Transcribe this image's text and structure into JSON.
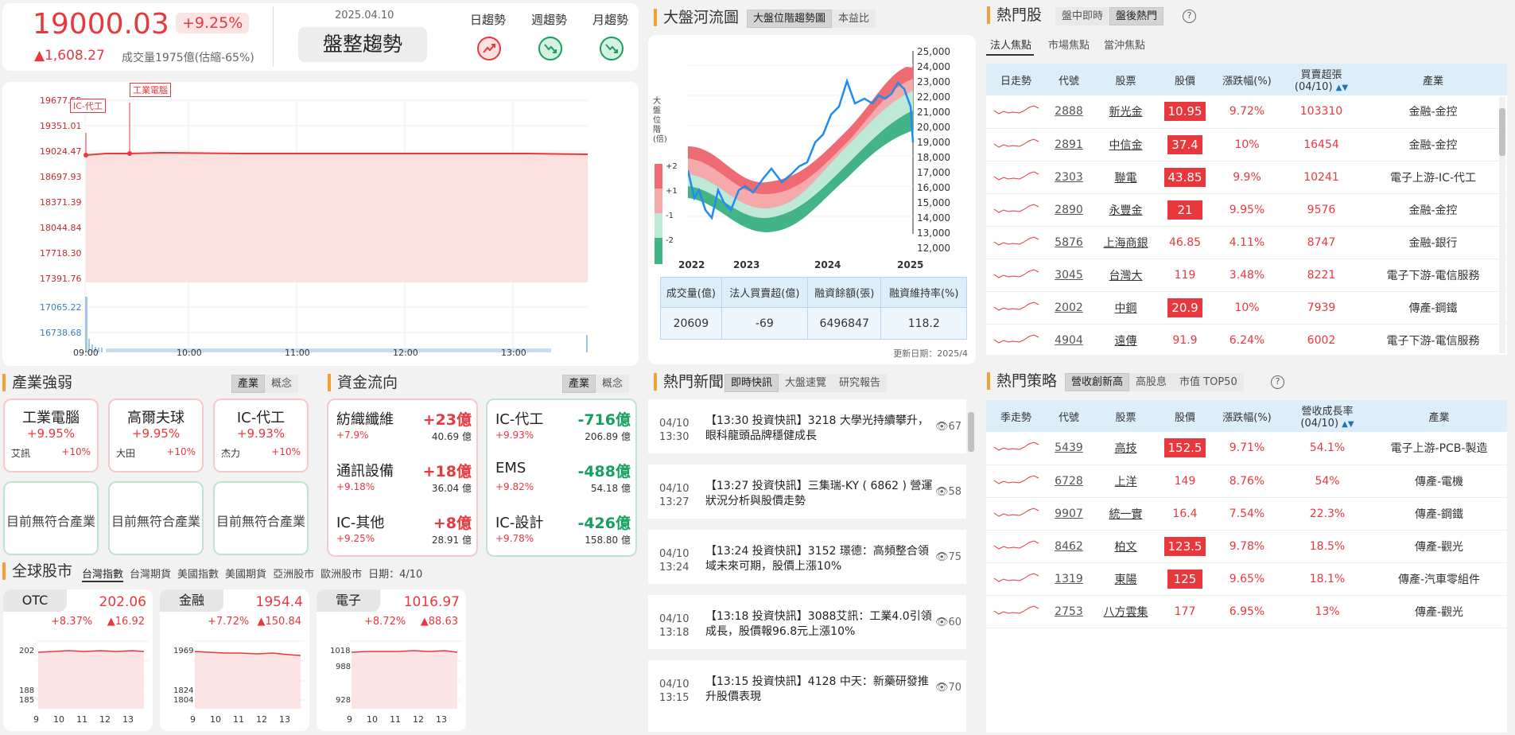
{
  "market": {
    "index": "19000.03",
    "pct": "+9.25%",
    "change": "▲1,608.27",
    "volume": "成交量1975億(估縮-65%)",
    "date": "2025.04.10",
    "trend": "盤整趨勢",
    "trend_labels": [
      "日趨勢",
      "週趨勢",
      "月趨勢"
    ]
  },
  "intraday_chart": {
    "price_ticks": [
      "19677.55",
      "19351.01",
      "19024.47",
      "18697.93",
      "18371.39",
      "18044.84",
      "17718.30",
      "17391.76"
    ],
    "volume_ticks": [
      "17065.22",
      "16738.68"
    ],
    "time_ticks": [
      "09:00",
      "10:00",
      "11:00",
      "12:00",
      "13:00"
    ],
    "annotations": [
      "IC-代工",
      "工業電腦"
    ]
  },
  "river": {
    "title": "大盤河流圖",
    "tabs": [
      "大盤位階趨勢圖",
      "本益比"
    ],
    "y_label": "大盤位階(倍)",
    "band_labels": [
      "+2",
      "+1",
      "-1",
      "-2"
    ],
    "y_ticks": [
      "25,000",
      "24,000",
      "23,000",
      "22,000",
      "21,000",
      "20,000",
      "19,000",
      "18,000",
      "17,000",
      "16,000",
      "15,000",
      "14,000",
      "13,000",
      "12,000"
    ],
    "x_ticks": [
      "2022",
      "2023",
      "2024",
      "2025"
    ],
    "table_headers": [
      "成交量(億)",
      "法人買賣超(億)",
      "融資餘額(張)",
      "融資維持率(%)"
    ],
    "table_values": [
      "20609",
      "-69",
      "6496847",
      "118.2"
    ],
    "update": "更新日期：2025/4"
  },
  "hot_stocks": {
    "title": "熱門股",
    "tabs": [
      "盤中即時",
      "盤後熱門"
    ],
    "subtabs": [
      "法人焦點",
      "市場焦點",
      "當沖焦點"
    ],
    "headers": [
      "日走勢",
      "代號",
      "股票",
      "股價",
      "漲跌幅(%)",
      "買賣超張(04/10)",
      "產業"
    ],
    "rows": [
      {
        "code": "2888",
        "name": "新光金",
        "price": "10.95",
        "pct": "9.72%",
        "net": "103310",
        "ind": "金融-金控",
        "hl": true
      },
      {
        "code": "2891",
        "name": "中信金",
        "price": "37.4",
        "pct": "10%",
        "net": "16454",
        "ind": "金融-金控",
        "hl": true
      },
      {
        "code": "2303",
        "name": "聯電",
        "price": "43.85",
        "pct": "9.9%",
        "net": "10241",
        "ind": "電子上游-IC-代工",
        "hl": true
      },
      {
        "code": "2890",
        "name": "永豐金",
        "price": "21",
        "pct": "9.95%",
        "net": "9576",
        "ind": "金融-金控",
        "hl": true
      },
      {
        "code": "5876",
        "name": "上海商銀",
        "price": "46.85",
        "pct": "4.11%",
        "net": "8747",
        "ind": "金融-銀行",
        "hl": false
      },
      {
        "code": "3045",
        "name": "台灣大",
        "price": "119",
        "pct": "3.48%",
        "net": "8221",
        "ind": "電子下游-電信服務",
        "hl": false
      },
      {
        "code": "2002",
        "name": "中鋼",
        "price": "20.9",
        "pct": "10%",
        "net": "7939",
        "ind": "傳產-鋼鐵",
        "hl": true
      },
      {
        "code": "4904",
        "name": "遠傳",
        "price": "91.9",
        "pct": "6.24%",
        "net": "6002",
        "ind": "電子下游-電信服務",
        "hl": false
      }
    ]
  },
  "strategy": {
    "title": "熱門策略",
    "tabs": [
      "營收創新高",
      "高股息",
      "市值 TOP50"
    ],
    "headers": [
      "季走勢",
      "代號",
      "股票",
      "股價",
      "漲跌幅(%)",
      "營收成長率(04/10)",
      "產業"
    ],
    "rows": [
      {
        "code": "5439",
        "name": "高技",
        "price": "152.5",
        "pct": "9.71%",
        "growth": "54.1%",
        "ind": "電子上游-PCB-製造",
        "hl": true
      },
      {
        "code": "6728",
        "name": "上洋",
        "price": "149",
        "pct": "8.76%",
        "growth": "54%",
        "ind": "傳產-電機",
        "hl": false
      },
      {
        "code": "9907",
        "name": "統一實",
        "price": "16.4",
        "pct": "7.54%",
        "growth": "22.3%",
        "ind": "傳產-鋼鐵",
        "hl": false
      },
      {
        "code": "8462",
        "name": "柏文",
        "price": "123.5",
        "pct": "9.78%",
        "growth": "18.5%",
        "ind": "傳產-觀光",
        "hl": true
      },
      {
        "code": "1319",
        "name": "東陽",
        "price": "125",
        "pct": "9.65%",
        "growth": "18.1%",
        "ind": "傳產-汽車零組件",
        "hl": true
      },
      {
        "code": "2753",
        "name": "八方雲集",
        "price": "177",
        "pct": "6.95%",
        "growth": "13%",
        "ind": "傳產-觀光",
        "hl": false
      }
    ]
  },
  "industry": {
    "title": "產業強弱",
    "tabs": [
      "產業",
      "概念"
    ],
    "top": [
      {
        "name": "工業電腦",
        "pct": "+9.95%",
        "stock": "艾訊",
        "spct": "+10%"
      },
      {
        "name": "高爾夫球",
        "pct": "+9.95%",
        "stock": "大田",
        "spct": "+10%"
      },
      {
        "name": "IC-代工",
        "pct": "+9.93%",
        "stock": "杰力",
        "spct": "+10%"
      }
    ],
    "empty": "目前無符合產業"
  },
  "flow": {
    "title": "資金流向",
    "tabs": [
      "產業",
      "概念"
    ],
    "in": [
      {
        "name": "紡織纖維",
        "val": "+23億",
        "pct": "+7.9%",
        "amt": "40.69 億"
      },
      {
        "name": "通訊設備",
        "val": "+18億",
        "pct": "+9.18%",
        "amt": "36.04 億"
      },
      {
        "name": "IC-其他",
        "val": "+8億",
        "pct": "+9.25%",
        "amt": "28.91 億"
      }
    ],
    "out": [
      {
        "name": "IC-代工",
        "val": "-716億",
        "pct": "+9.93%",
        "amt": "206.89 億"
      },
      {
        "name": "EMS",
        "val": "-488億",
        "pct": "+9.82%",
        "amt": "54.18 億"
      },
      {
        "name": "IC-設計",
        "val": "-426億",
        "pct": "+9.78%",
        "amt": "158.80 億"
      }
    ]
  },
  "news": {
    "title": "熱門新聞",
    "tabs": [
      "即時快訊",
      "大盤速覽",
      "研究報告"
    ],
    "items": [
      {
        "date": "04/10",
        "time": "13:30",
        "title": "【13:30 投資快訊】3218 大學光持續攀升，眼科龍頭品牌穩健成長",
        "views": "67"
      },
      {
        "date": "04/10",
        "time": "13:27",
        "title": "【13:27 投資快訊】三集瑞-KY ( 6862 ) 營運狀況分析與股價走勢",
        "views": "58"
      },
      {
        "date": "04/10",
        "time": "13:24",
        "title": "【13:24 投資快訊】3152 璟德：高頻整合領域未來可期，股價上漲10%",
        "views": "75"
      },
      {
        "date": "04/10",
        "time": "13:18",
        "title": "【13:18 投資快訊】3088艾訊：工業4.0引領成長，股價報96.8元上漲10%",
        "views": "60"
      },
      {
        "date": "04/10",
        "time": "13:15",
        "title": "【13:15 投資快訊】4128 中天：新藥研發推升股價表現",
        "views": "70"
      }
    ]
  },
  "global": {
    "title": "全球股市",
    "tabs": [
      "台灣指數",
      "台灣期貨",
      "美國指數",
      "美國期貨",
      "亞洲股市",
      "歐洲股市"
    ],
    "date": "日期：4/10",
    "cards": [
      {
        "name": "OTC",
        "val": "202.06",
        "pct": "+8.37%",
        "chg": "▲16.92",
        "ticks": [
          "202",
          "188",
          "185"
        ]
      },
      {
        "name": "金融",
        "val": "1954.4",
        "pct": "+7.72%",
        "chg": "▲150.84",
        "ticks": [
          "1969",
          "1824",
          "1804"
        ]
      },
      {
        "name": "電子",
        "val": "1016.97",
        "pct": "+8.72%",
        "chg": "▲88.63",
        "ticks": [
          "1018",
          "988",
          "928"
        ]
      }
    ],
    "x_ticks": [
      "9",
      "10",
      "11",
      "12",
      "13"
    ]
  }
}
